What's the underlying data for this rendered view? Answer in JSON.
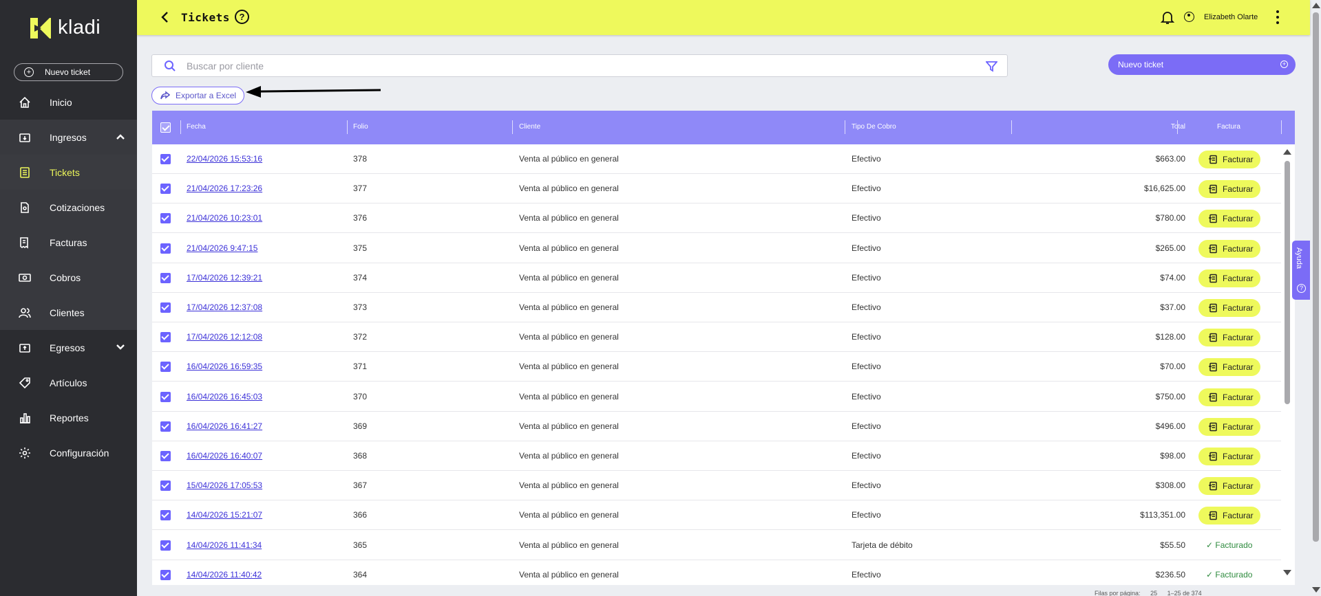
{
  "app": {
    "logo_text": "kladi",
    "brand_color": "#eef95c",
    "accent_color": "#7b6cf6"
  },
  "sidebar": {
    "new_ticket_label": "Nuevo ticket",
    "items": [
      {
        "label": "Inicio",
        "icon": "home-icon"
      },
      {
        "label": "Ingresos",
        "icon": "income-icon",
        "expanded": true
      },
      {
        "label": "Tickets",
        "icon": "tickets-icon",
        "active": true
      },
      {
        "label": "Cotizaciones",
        "icon": "quote-icon"
      },
      {
        "label": "Facturas",
        "icon": "invoice-icon"
      },
      {
        "label": "Cobros",
        "icon": "cash-icon"
      },
      {
        "label": "Clientes",
        "icon": "users-icon"
      },
      {
        "label": "Egresos",
        "icon": "expense-icon",
        "expanded": false
      },
      {
        "label": "Artículos",
        "icon": "tag-icon"
      },
      {
        "label": "Reportes",
        "icon": "chart-icon"
      },
      {
        "label": "Configuración",
        "icon": "gear-icon"
      }
    ]
  },
  "header": {
    "title": "Tickets",
    "user_name": "Elizabeth Olarte"
  },
  "search": {
    "placeholder": "Buscar por cliente",
    "value": ""
  },
  "actions": {
    "new_ticket": "Nuevo ticket",
    "export": "Exportar a Excel"
  },
  "table": {
    "columns": {
      "fecha": "Fecha",
      "folio": "Folio",
      "cliente": "Cliente",
      "tipo": "Tipo De Cobro",
      "total": "Total",
      "factura": "Factura"
    },
    "invoice_button": "Facturar",
    "invoiced_label": "✓ Facturado",
    "rows": [
      {
        "fecha": "22/04/2026 15:53:16",
        "folio": "378",
        "cliente": "Venta al público en general",
        "tipo": "Efectivo",
        "total": "$663.00",
        "facturado": false
      },
      {
        "fecha": "21/04/2026 17:23:26",
        "folio": "377",
        "cliente": "Venta al público en general",
        "tipo": "Efectivo",
        "total": "$16,625.00",
        "facturado": false
      },
      {
        "fecha": "21/04/2026 10:23:01",
        "folio": "376",
        "cliente": "Venta al público en general",
        "tipo": "Efectivo",
        "total": "$780.00",
        "facturado": false
      },
      {
        "fecha": "21/04/2026 9:47:15",
        "folio": "375",
        "cliente": "Venta al público en general",
        "tipo": "Efectivo",
        "total": "$265.00",
        "facturado": false
      },
      {
        "fecha": "17/04/2026 12:39:21",
        "folio": "374",
        "cliente": "Venta al público en general",
        "tipo": "Efectivo",
        "total": "$74.00",
        "facturado": false
      },
      {
        "fecha": "17/04/2026 12:37:08",
        "folio": "373",
        "cliente": "Venta al público en general",
        "tipo": "Efectivo",
        "total": "$37.00",
        "facturado": false
      },
      {
        "fecha": "17/04/2026 12:12:08",
        "folio": "372",
        "cliente": "Venta al público en general",
        "tipo": "Efectivo",
        "total": "$128.00",
        "facturado": false
      },
      {
        "fecha": "16/04/2026 16:59:35",
        "folio": "371",
        "cliente": "Venta al público en general",
        "tipo": "Efectivo",
        "total": "$70.00",
        "facturado": false
      },
      {
        "fecha": "16/04/2026 16:45:03",
        "folio": "370",
        "cliente": "Venta al público en general",
        "tipo": "Efectivo",
        "total": "$750.00",
        "facturado": false
      },
      {
        "fecha": "16/04/2026 16:41:27",
        "folio": "369",
        "cliente": "Venta al público en general",
        "tipo": "Efectivo",
        "total": "$496.00",
        "facturado": false
      },
      {
        "fecha": "16/04/2026 16:40:07",
        "folio": "368",
        "cliente": "Venta al público en general",
        "tipo": "Efectivo",
        "total": "$98.00",
        "facturado": false
      },
      {
        "fecha": "15/04/2026 17:05:53",
        "folio": "367",
        "cliente": "Venta al público en general",
        "tipo": "Efectivo",
        "total": "$308.00",
        "facturado": false
      },
      {
        "fecha": "14/04/2026 15:21:07",
        "folio": "366",
        "cliente": "Venta al público en general",
        "tipo": "Efectivo",
        "total": "$113,351.00",
        "facturado": false
      },
      {
        "fecha": "14/04/2026 11:41:34",
        "folio": "365",
        "cliente": "Venta al público en general",
        "tipo": "Tarjeta de débito",
        "total": "$55.50",
        "facturado": true
      },
      {
        "fecha": "14/04/2026 11:40:42",
        "folio": "364",
        "cliente": "Venta al público en general",
        "tipo": "Efectivo",
        "total": "$236.50",
        "facturado": true
      }
    ]
  },
  "pagination": {
    "rows_per_page_label": "Filas por página:",
    "rows_per_page": "25",
    "range": "1–25 de 374"
  },
  "help_tab": {
    "label": "Ayuda"
  }
}
